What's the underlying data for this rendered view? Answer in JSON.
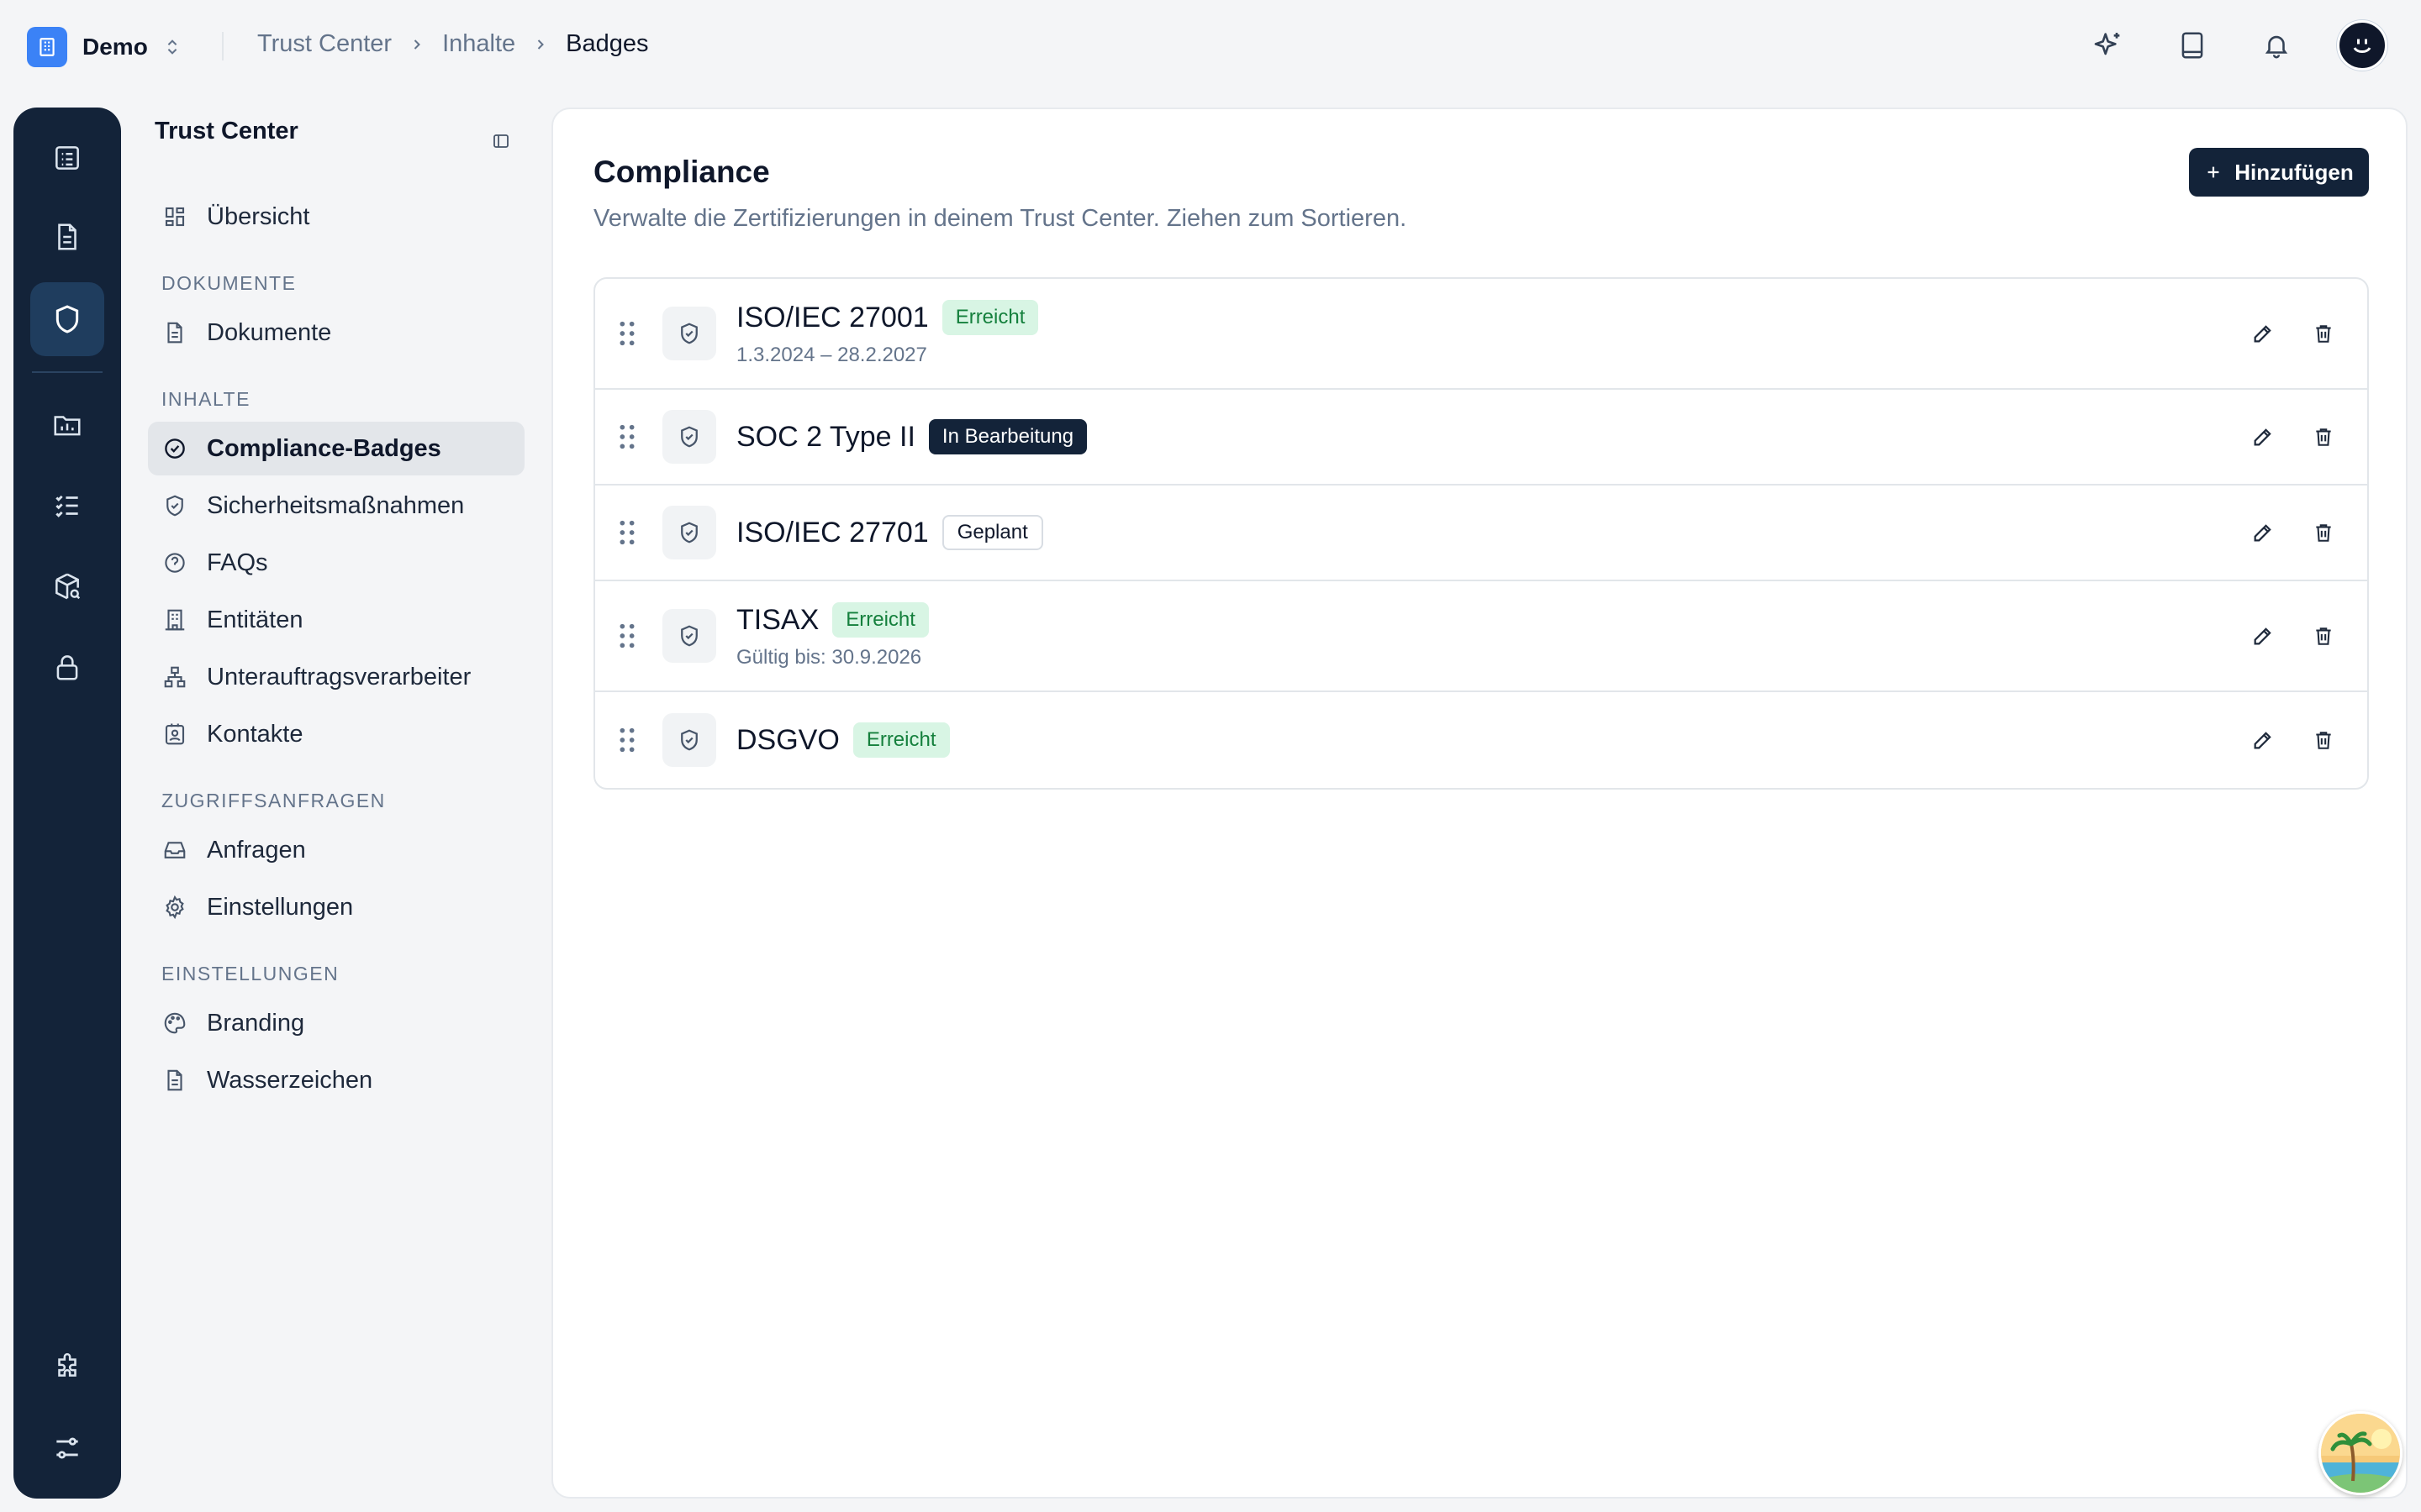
{
  "org": {
    "name": "Demo"
  },
  "breadcrumb": [
    "Trust Center",
    "Inhalte",
    "Badges"
  ],
  "sidebar": {
    "title": "Trust Center",
    "overview": "Übersicht",
    "sections": {
      "docs": "DOKUMENTE",
      "content": "INHALTE",
      "access": "ZUGRIFFSANFRAGEN",
      "settings": "EINSTELLUNGEN"
    },
    "items": {
      "documents": "Dokumente",
      "compliance": "Compliance-Badges",
      "security": "Sicherheitsmaßnahmen",
      "faqs": "FAQs",
      "entities": "Entitäten",
      "subprocessors": "Unterauftragsverarbeiter",
      "contacts": "Kontakte",
      "requests": "Anfragen",
      "access_settings": "Einstellungen",
      "branding": "Branding",
      "watermark": "Wasserzeichen"
    }
  },
  "main": {
    "title": "Compliance",
    "subtitle": "Verwalte die Zertifizierungen in deinem Trust Center. Ziehen zum Sortieren.",
    "add_label": "Hinzufügen",
    "badges": [
      {
        "name": "ISO/IEC 27001",
        "status": "Erreicht",
        "sub": "1.3.2024 – 28.2.2027"
      },
      {
        "name": "SOC 2 Type II",
        "status": "In Bearbeitung",
        "sub": ""
      },
      {
        "name": "ISO/IEC 27701",
        "status": "Geplant",
        "sub": ""
      },
      {
        "name": "TISAX",
        "status": "Erreicht",
        "sub": "Gültig bis: 30.9.2026"
      },
      {
        "name": "DSGVO",
        "status": "Erreicht",
        "sub": ""
      }
    ]
  },
  "colors": {
    "rail": "#132339",
    "accent_blue": "#3b82f6",
    "success_bg": "#d8f5e4",
    "success_text": "#15803d"
  }
}
